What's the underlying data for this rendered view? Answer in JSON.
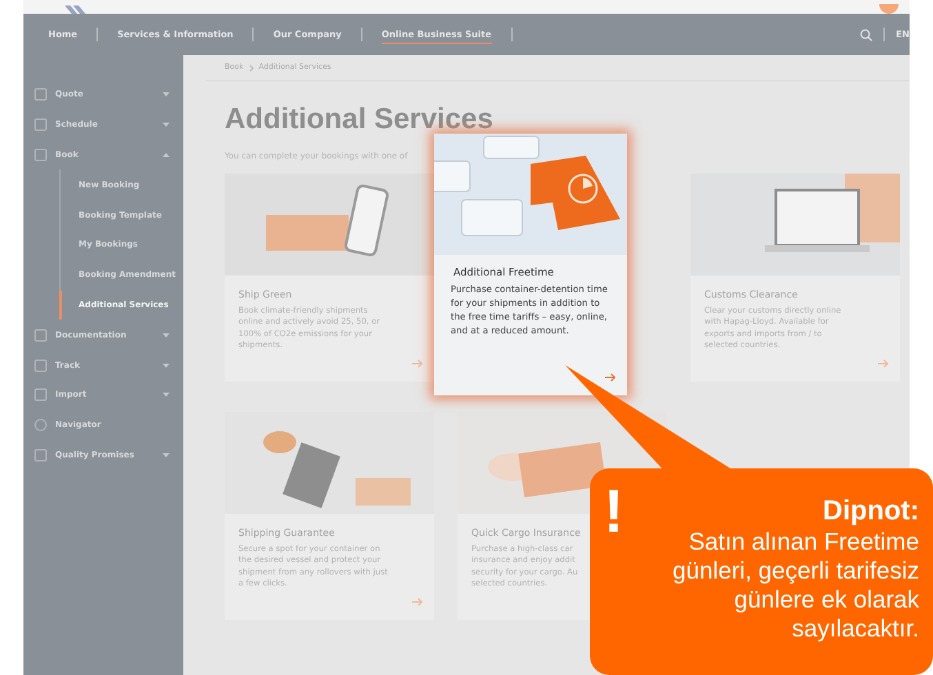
{
  "nav": {
    "items": [
      {
        "label": "Home",
        "selected": false
      },
      {
        "label": "Services & Information",
        "selected": false
      },
      {
        "label": "Our Company",
        "selected": false
      },
      {
        "label": "Online Business Suite",
        "selected": true
      }
    ],
    "language": "EN"
  },
  "sidebar": {
    "items": [
      {
        "label": "Quote",
        "kind": "group",
        "expanded": false
      },
      {
        "label": "Schedule",
        "kind": "group",
        "expanded": false
      },
      {
        "label": "Book",
        "kind": "group",
        "expanded": true,
        "children": [
          {
            "label": "New Booking",
            "selected": false
          },
          {
            "label": "Booking Template",
            "selected": false
          },
          {
            "label": "My Bookings",
            "selected": false
          },
          {
            "label": "Booking Amendment",
            "selected": false
          },
          {
            "label": "Additional Services",
            "selected": true
          }
        ]
      },
      {
        "label": "Documentation",
        "kind": "group",
        "expanded": false
      },
      {
        "label": "Track",
        "kind": "group",
        "expanded": false
      },
      {
        "label": "Import",
        "kind": "group",
        "expanded": false
      },
      {
        "label": "Navigator",
        "kind": "link"
      },
      {
        "label": "Quality Promises",
        "kind": "group",
        "expanded": false
      }
    ]
  },
  "breadcrumb": [
    "Book",
    "Additional Services"
  ],
  "page": {
    "title": "Additional Services",
    "intro": "You can complete your bookings with one of"
  },
  "cards": [
    {
      "kind": "service",
      "title": "Ship Green",
      "lines": [
        "Book climate-friendly shipments",
        "online and actively avoid 25, 50, or",
        "100% of CO2e emissions for your",
        "shipments."
      ]
    },
    {
      "kind": "highlight",
      "title": "Additional Freetime",
      "text": "Purchase container-detention time for your shipments in addition to the free time tariffs – easy, online, and at a reduced amount."
    },
    {
      "kind": "service",
      "title": "Customs Clearance",
      "lines": [
        "Clear your customs directly online",
        "with Hapag-Lloyd. Available for",
        "exports and imports from / to",
        "selected countries."
      ]
    },
    {
      "kind": "service",
      "title": "Shipping Guarantee",
      "lines": [
        "Secure a spot for your container on",
        "the desired vessel and protect your",
        "shipment from any rollovers with just",
        "a few clicks."
      ]
    },
    {
      "kind": "service",
      "title": "Quick Cargo Insurance",
      "lines": [
        "Purchase a high-class car",
        "insurance and enjoy addit",
        "security for your cargo. Au",
        "selected countries."
      ]
    }
  ],
  "callout": {
    "mark": "!",
    "title": "Dipnot:",
    "text": "Satın alınan Freetime günleri, geçerli tarifesiz günlere ek olarak sayılacaktır."
  }
}
